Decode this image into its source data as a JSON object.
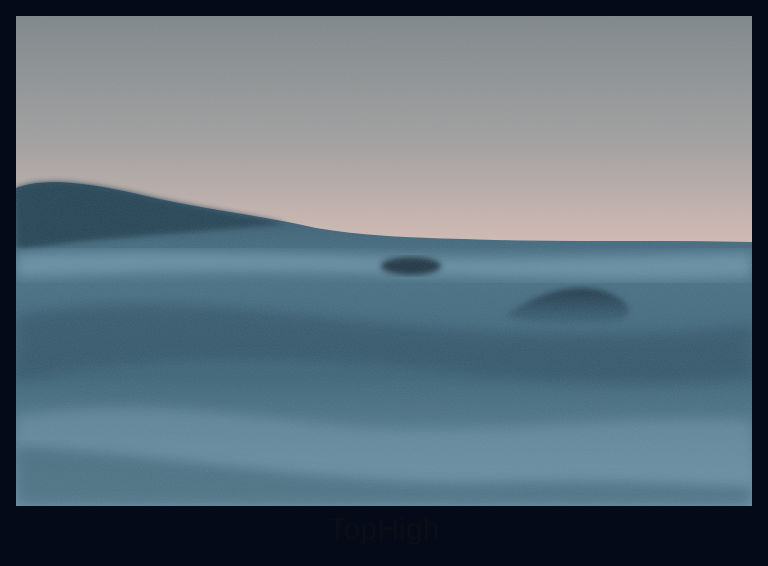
{
  "photo": {
    "subject": "ocean-waves-at-dusk",
    "colors": {
      "sky_top": "#7f8588",
      "sky_mid": "#a8a29e",
      "horizon_glow": "#d8bcb4",
      "water_light": "#6f95a8",
      "water_mid": "#3f6478",
      "water_dark": "#1c3444",
      "frame_bg": "#040a17"
    }
  },
  "caption": {
    "text": "TopHigh"
  }
}
